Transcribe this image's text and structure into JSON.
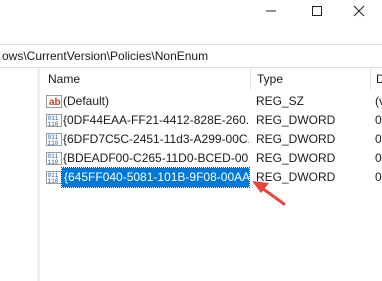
{
  "window": {
    "minimize_icon": "minimize-icon",
    "maximize_icon": "maximize-icon",
    "close_icon": "close-icon"
  },
  "address": {
    "path": "ows\\CurrentVersion\\Policies\\NonEnum"
  },
  "columns": {
    "name": "Name",
    "type": "Type",
    "data": "D"
  },
  "rows": [
    {
      "icon": "string-value-icon",
      "name": "(Default)",
      "type": "REG_SZ",
      "data": "(v"
    },
    {
      "icon": "binary-value-icon",
      "name": "{0DF44EAA-FF21-4412-828E-260...",
      "type": "REG_DWORD",
      "data": "0"
    },
    {
      "icon": "binary-value-icon",
      "name": "{6DFD7C5C-2451-11d3-A299-00C...",
      "type": "REG_DWORD",
      "data": "0"
    },
    {
      "icon": "binary-value-icon",
      "name": "{BDEADF00-C265-11D0-BCED-00...",
      "type": "REG_DWORD",
      "data": "0"
    },
    {
      "icon": "binary-value-icon",
      "name": "{645FF040-5081-101B-9F08-00AA...",
      "type": "REG_DWORD",
      "data": "0",
      "selected": true
    }
  ],
  "colors": {
    "selection": "#0078d7",
    "annotation_arrow": "#e8453c"
  }
}
